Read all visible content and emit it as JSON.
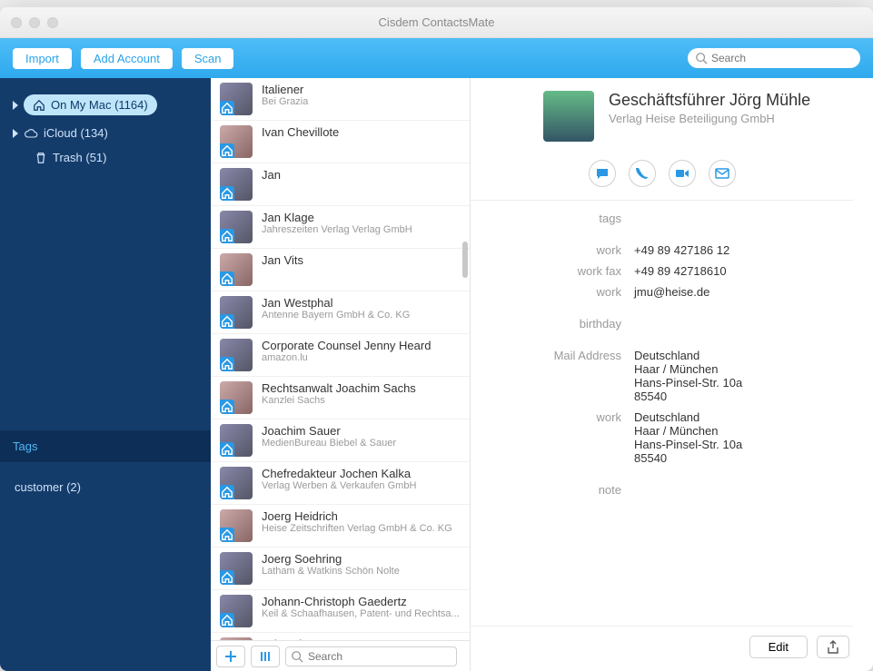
{
  "window_title": "Cisdem ContactsMate",
  "toolbar": {
    "import": "Import",
    "add_account": "Add Account",
    "scan": "Scan",
    "search_placeholder": "Search"
  },
  "sidebar": {
    "on_my_mac": "On My Mac (1164)",
    "icloud": "iCloud (134)",
    "trash": "Trash (51)",
    "tags_header": "Tags",
    "tags": [
      {
        "label": "customer (2)"
      }
    ]
  },
  "list": {
    "items": [
      {
        "name": "Italiener",
        "sub": "Bei Grazia"
      },
      {
        "name": "Ivan Chevillote",
        "sub": ""
      },
      {
        "name": "Jan",
        "sub": ""
      },
      {
        "name": "Jan Klage",
        "sub": "Jahreszeiten Verlag Verlag GmbH"
      },
      {
        "name": "Jan Vits",
        "sub": ""
      },
      {
        "name": "Jan Westphal",
        "sub": "Antenne Bayern GmbH & Co. KG"
      },
      {
        "name": "Corporate Counsel Jenny Heard",
        "sub": "amazon.lu"
      },
      {
        "name": "Rechtsanwalt Joachim Sachs",
        "sub": "Kanzlei Sachs"
      },
      {
        "name": "Joachim Sauer",
        "sub": "MedienBureau Biebel & Sauer"
      },
      {
        "name": "Chefredakteur Jochen Kalka",
        "sub": "Verlag Werben & Verkaufen GmbH"
      },
      {
        "name": "Joerg Heidrich",
        "sub": "Heise Zeitschriften Verlag GmbH & Co. KG"
      },
      {
        "name": "Joerg Soehring",
        "sub": "Latham & Watkins Schön Nolte"
      },
      {
        "name": "Johann-Christoph Gaedertz",
        "sub": "Keil & Schaafhausen, Patent- und Rechtsa..."
      },
      {
        "name": "John Chen",
        "sub": ""
      }
    ],
    "footer_search_placeholder": "Search"
  },
  "detail": {
    "name": "Geschäftsführer Jörg Mühle",
    "org": "Verlag Heise Beteiligung GmbH",
    "fields": [
      {
        "label": "tags",
        "value": ""
      },
      {
        "label": "work",
        "value": "+49 89 427186 12"
      },
      {
        "label": "work fax",
        "value": "+49 89 42718610"
      },
      {
        "label": "work",
        "value": "jmu@heise.de"
      },
      {
        "label": "birthday",
        "value": ""
      },
      {
        "label": "Mail Address",
        "value": "Deutschland\nHaar / München\nHans-Pinsel-Str. 10a\n85540"
      },
      {
        "label": "work",
        "value": "Deutschland\nHaar / München\nHans-Pinsel-Str. 10a\n85540"
      },
      {
        "label": "note",
        "value": ""
      }
    ],
    "edit": "Edit"
  }
}
